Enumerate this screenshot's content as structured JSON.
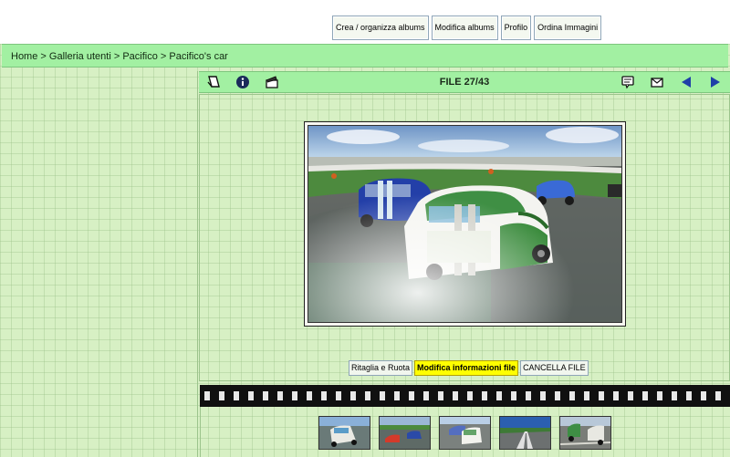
{
  "top_nav": {
    "items": [
      {
        "label": "Crea / organizza albums"
      },
      {
        "label": "Modifica albums"
      },
      {
        "label": "Profilo"
      },
      {
        "label": "Ordina Immagini"
      }
    ]
  },
  "breadcrumb": {
    "items": [
      "Home",
      "Galleria utenti",
      "Pacifico",
      "Pacifico's car"
    ],
    "separator": " > "
  },
  "toolbar": {
    "file_counter": "FILE 27/43",
    "icons_left": [
      "return-to-thumbnails-icon",
      "info-icon",
      "slideshow-icon"
    ],
    "icons_right": [
      "comment-icon",
      "ecard-email-icon",
      "previous-arrow-icon",
      "next-arrow-icon"
    ]
  },
  "image_actions": {
    "crop_rotate": "Ritaglia e Ruota",
    "edit_info": "Modifica informazioni file",
    "delete": "CANCELLA FILE"
  },
  "colors": {
    "bar_green": "#a2f0a2",
    "page_bg": "#d7f0c4",
    "highlight": "#ffff00",
    "arrow_blue": "#1f3fa8"
  }
}
